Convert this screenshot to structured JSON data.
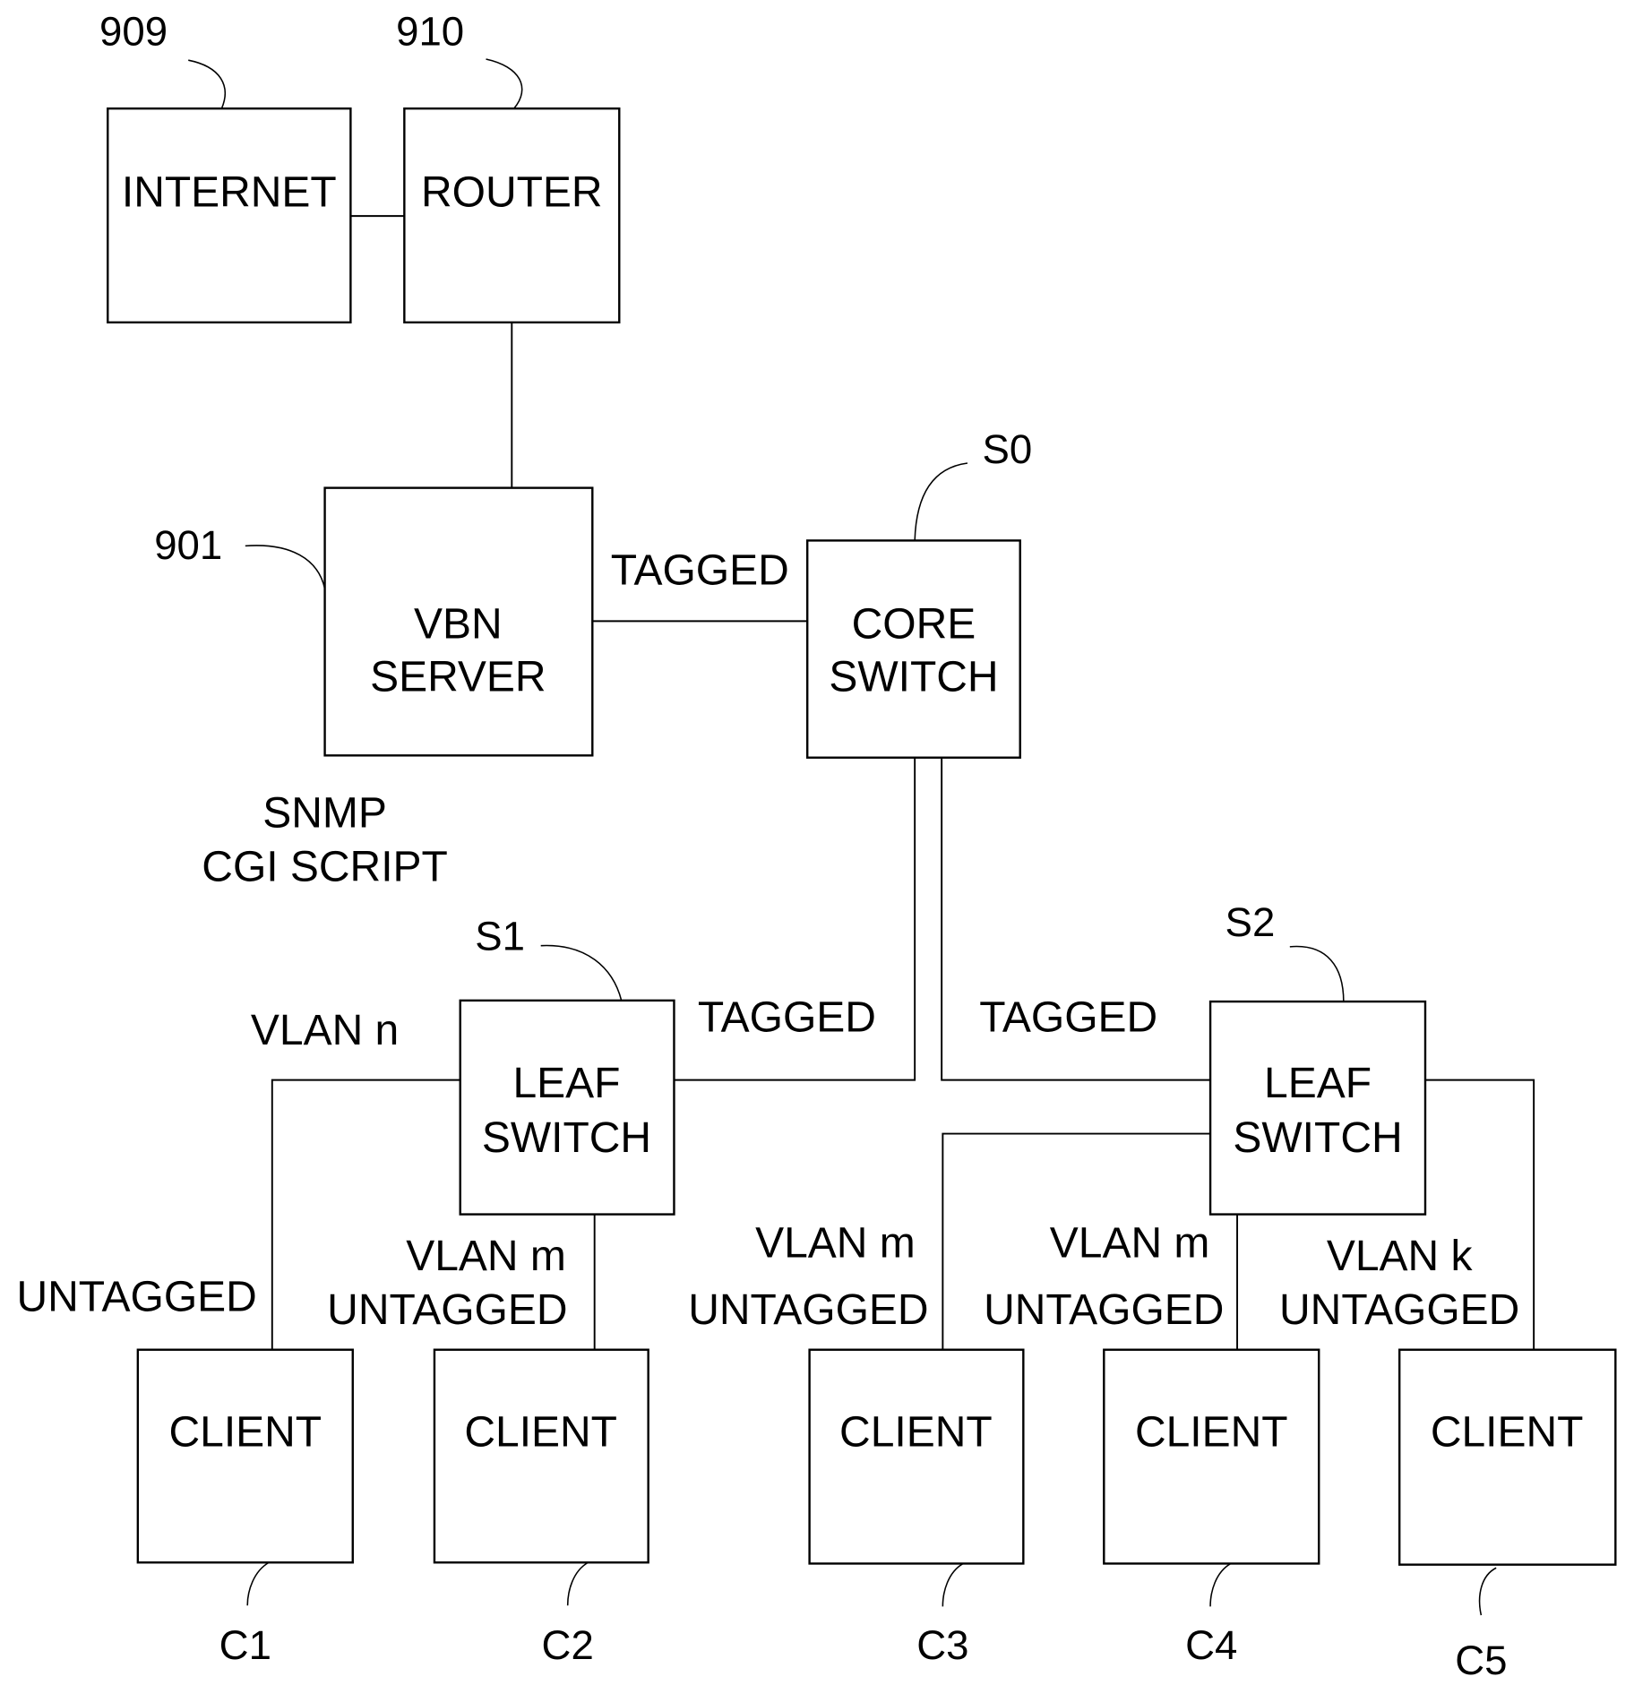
{
  "figure": {
    "nodes": {
      "internet": {
        "label": "INTERNET",
        "ref": "909"
      },
      "router": {
        "label": "ROUTER",
        "ref": "910"
      },
      "vbn_server": {
        "line1": "VBN",
        "line2": "SERVER",
        "ref": "901"
      },
      "core_switch": {
        "line1": "CORE",
        "line2": "SWITCH",
        "ref": "S0"
      },
      "leaf_switch_1": {
        "line1": "LEAF",
        "line2": "SWITCH",
        "ref": "S1"
      },
      "leaf_switch_2": {
        "line1": "LEAF",
        "line2": "SWITCH",
        "ref": "S2"
      },
      "clients": [
        {
          "label": "CLIENT",
          "ref": "C1"
        },
        {
          "label": "CLIENT",
          "ref": "C2"
        },
        {
          "label": "CLIENT",
          "ref": "C3"
        },
        {
          "label": "CLIENT",
          "ref": "C4"
        },
        {
          "label": "CLIENT",
          "ref": "C5"
        }
      ]
    },
    "annotations": {
      "server_software_line1": "SNMP",
      "server_software_line2": "CGI SCRIPT",
      "server_core_link": "TAGGED",
      "core_s1_link": "TAGGED",
      "core_s2_link": "TAGGED",
      "s1_vlan": "VLAN n",
      "c1_link": "UNTAGGED",
      "c2_vlan": "VLAN m",
      "c2_link": "UNTAGGED",
      "c3_vlan": "VLAN m",
      "c3_link": "UNTAGGED",
      "c4_vlan": "VLAN m",
      "c4_link": "UNTAGGED",
      "c5_vlan": "VLAN k",
      "c5_link": "UNTAGGED"
    }
  }
}
